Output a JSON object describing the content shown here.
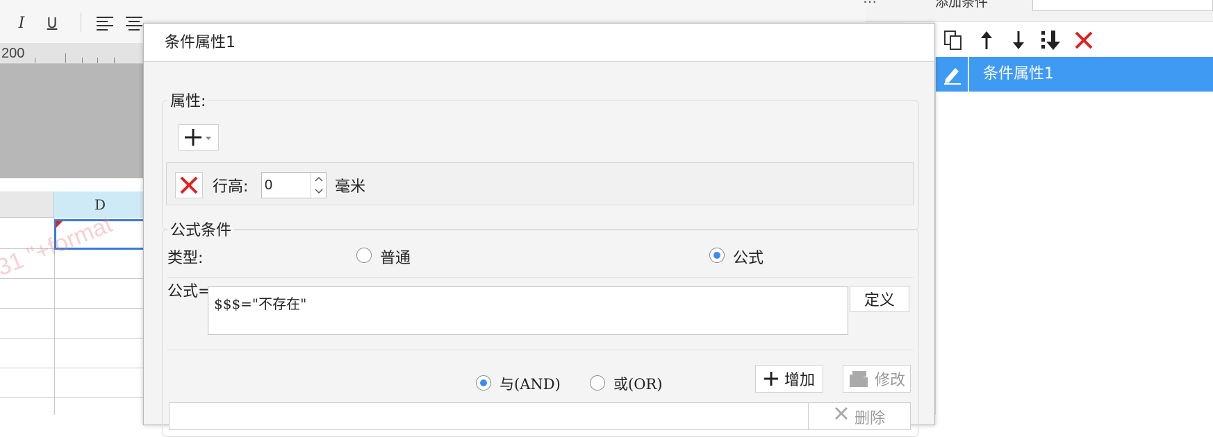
{
  "toolbar": {
    "italic_label": "I",
    "underline_label": "U"
  },
  "ruler": {
    "label": "200"
  },
  "sheet": {
    "column_d_label": "D",
    "watermark": "31 \"+format"
  },
  "side_panel": {
    "top_label": "添加条件",
    "selected_item_label": "条件属性1"
  },
  "dialog": {
    "title": "条件属性1",
    "attr_group_title": "属性:",
    "row_height_label": "行高:",
    "row_height_value": "0",
    "row_height_unit": "毫米",
    "formula_group_title": "公式条件",
    "type_label": "类型:",
    "type_options": [
      {
        "label": "普通",
        "selected": false
      },
      {
        "label": "公式",
        "selected": true
      }
    ],
    "formula_label": "公式=",
    "formula_value": "$$$=\"不存在\"",
    "define_button": "定义",
    "logic_options": [
      {
        "label": "与(AND)",
        "selected": true
      },
      {
        "label": "或(OR)",
        "selected": false
      }
    ],
    "add_button": "增加",
    "modify_button": "修改",
    "delete_button": "删除"
  },
  "colors": {
    "accent": "#3f9af3",
    "delete_red": "#e02020",
    "radio_blue": "#3a8ee6"
  }
}
